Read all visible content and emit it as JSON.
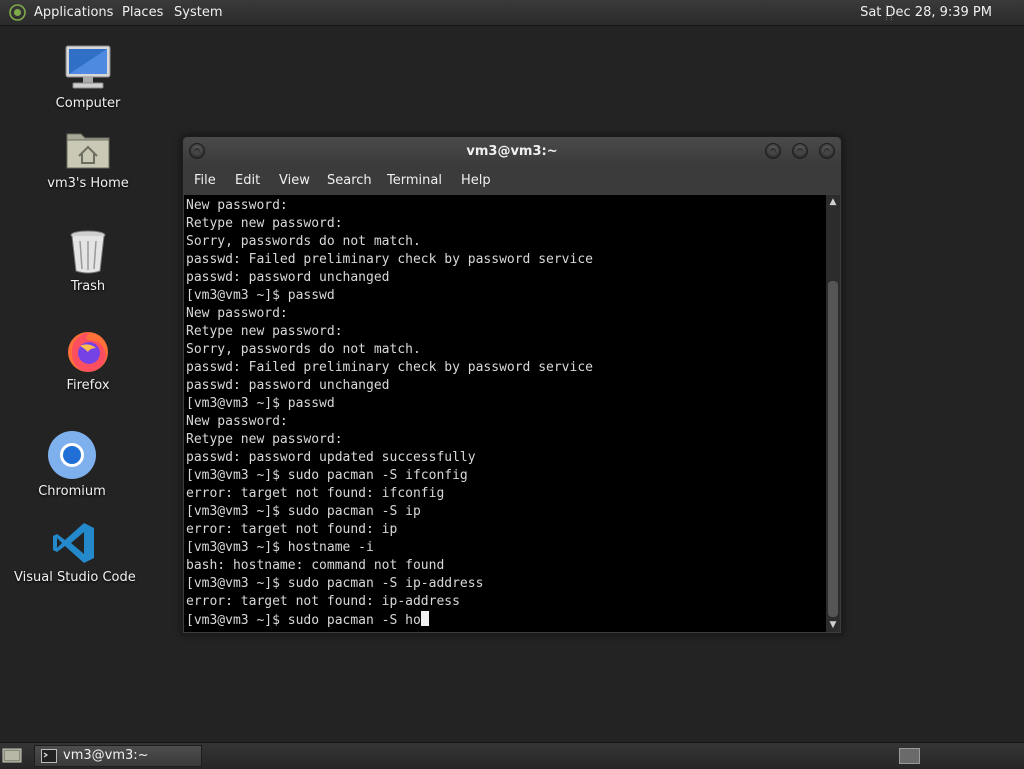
{
  "top_panel": {
    "menus": [
      "Applications",
      "Places",
      "System"
    ],
    "clock": "Sat Dec 28,  9:39 PM"
  },
  "desktop_icons": [
    {
      "label": "Computer",
      "icon": "computer-icon"
    },
    {
      "label": "vm3's Home",
      "icon": "home-folder-icon"
    },
    {
      "label": "Trash",
      "icon": "trash-icon"
    },
    {
      "label": "Firefox",
      "icon": "firefox-icon"
    },
    {
      "label": "Chromium",
      "icon": "chromium-icon"
    },
    {
      "label": "Visual Studio Code",
      "icon": "vscode-icon"
    }
  ],
  "terminal": {
    "title": "vm3@vm3:~",
    "menu": [
      "File",
      "Edit",
      "View",
      "Search",
      "Terminal",
      "Help"
    ],
    "lines": [
      "New password:",
      "Retype new password:",
      "Sorry, passwords do not match.",
      "passwd: Failed preliminary check by password service",
      "passwd: password unchanged",
      "[vm3@vm3 ~]$ passwd",
      "New password:",
      "Retype new password:",
      "Sorry, passwords do not match.",
      "passwd: Failed preliminary check by password service",
      "passwd: password unchanged",
      "[vm3@vm3 ~]$ passwd",
      "New password:",
      "Retype new password:",
      "passwd: password updated successfully",
      "[vm3@vm3 ~]$ sudo pacman -S ifconfig",
      "error: target not found: ifconfig",
      "[vm3@vm3 ~]$ sudo pacman -S ip",
      "error: target not found: ip",
      "[vm3@vm3 ~]$ hostname -i",
      "bash: hostname: command not found",
      "[vm3@vm3 ~]$ sudo pacman -S ip-address",
      "error: target not found: ip-address"
    ],
    "prompt_line": "[vm3@vm3 ~]$ sudo pacman -S ho"
  },
  "taskbar": {
    "task_label": "vm3@vm3:~"
  }
}
